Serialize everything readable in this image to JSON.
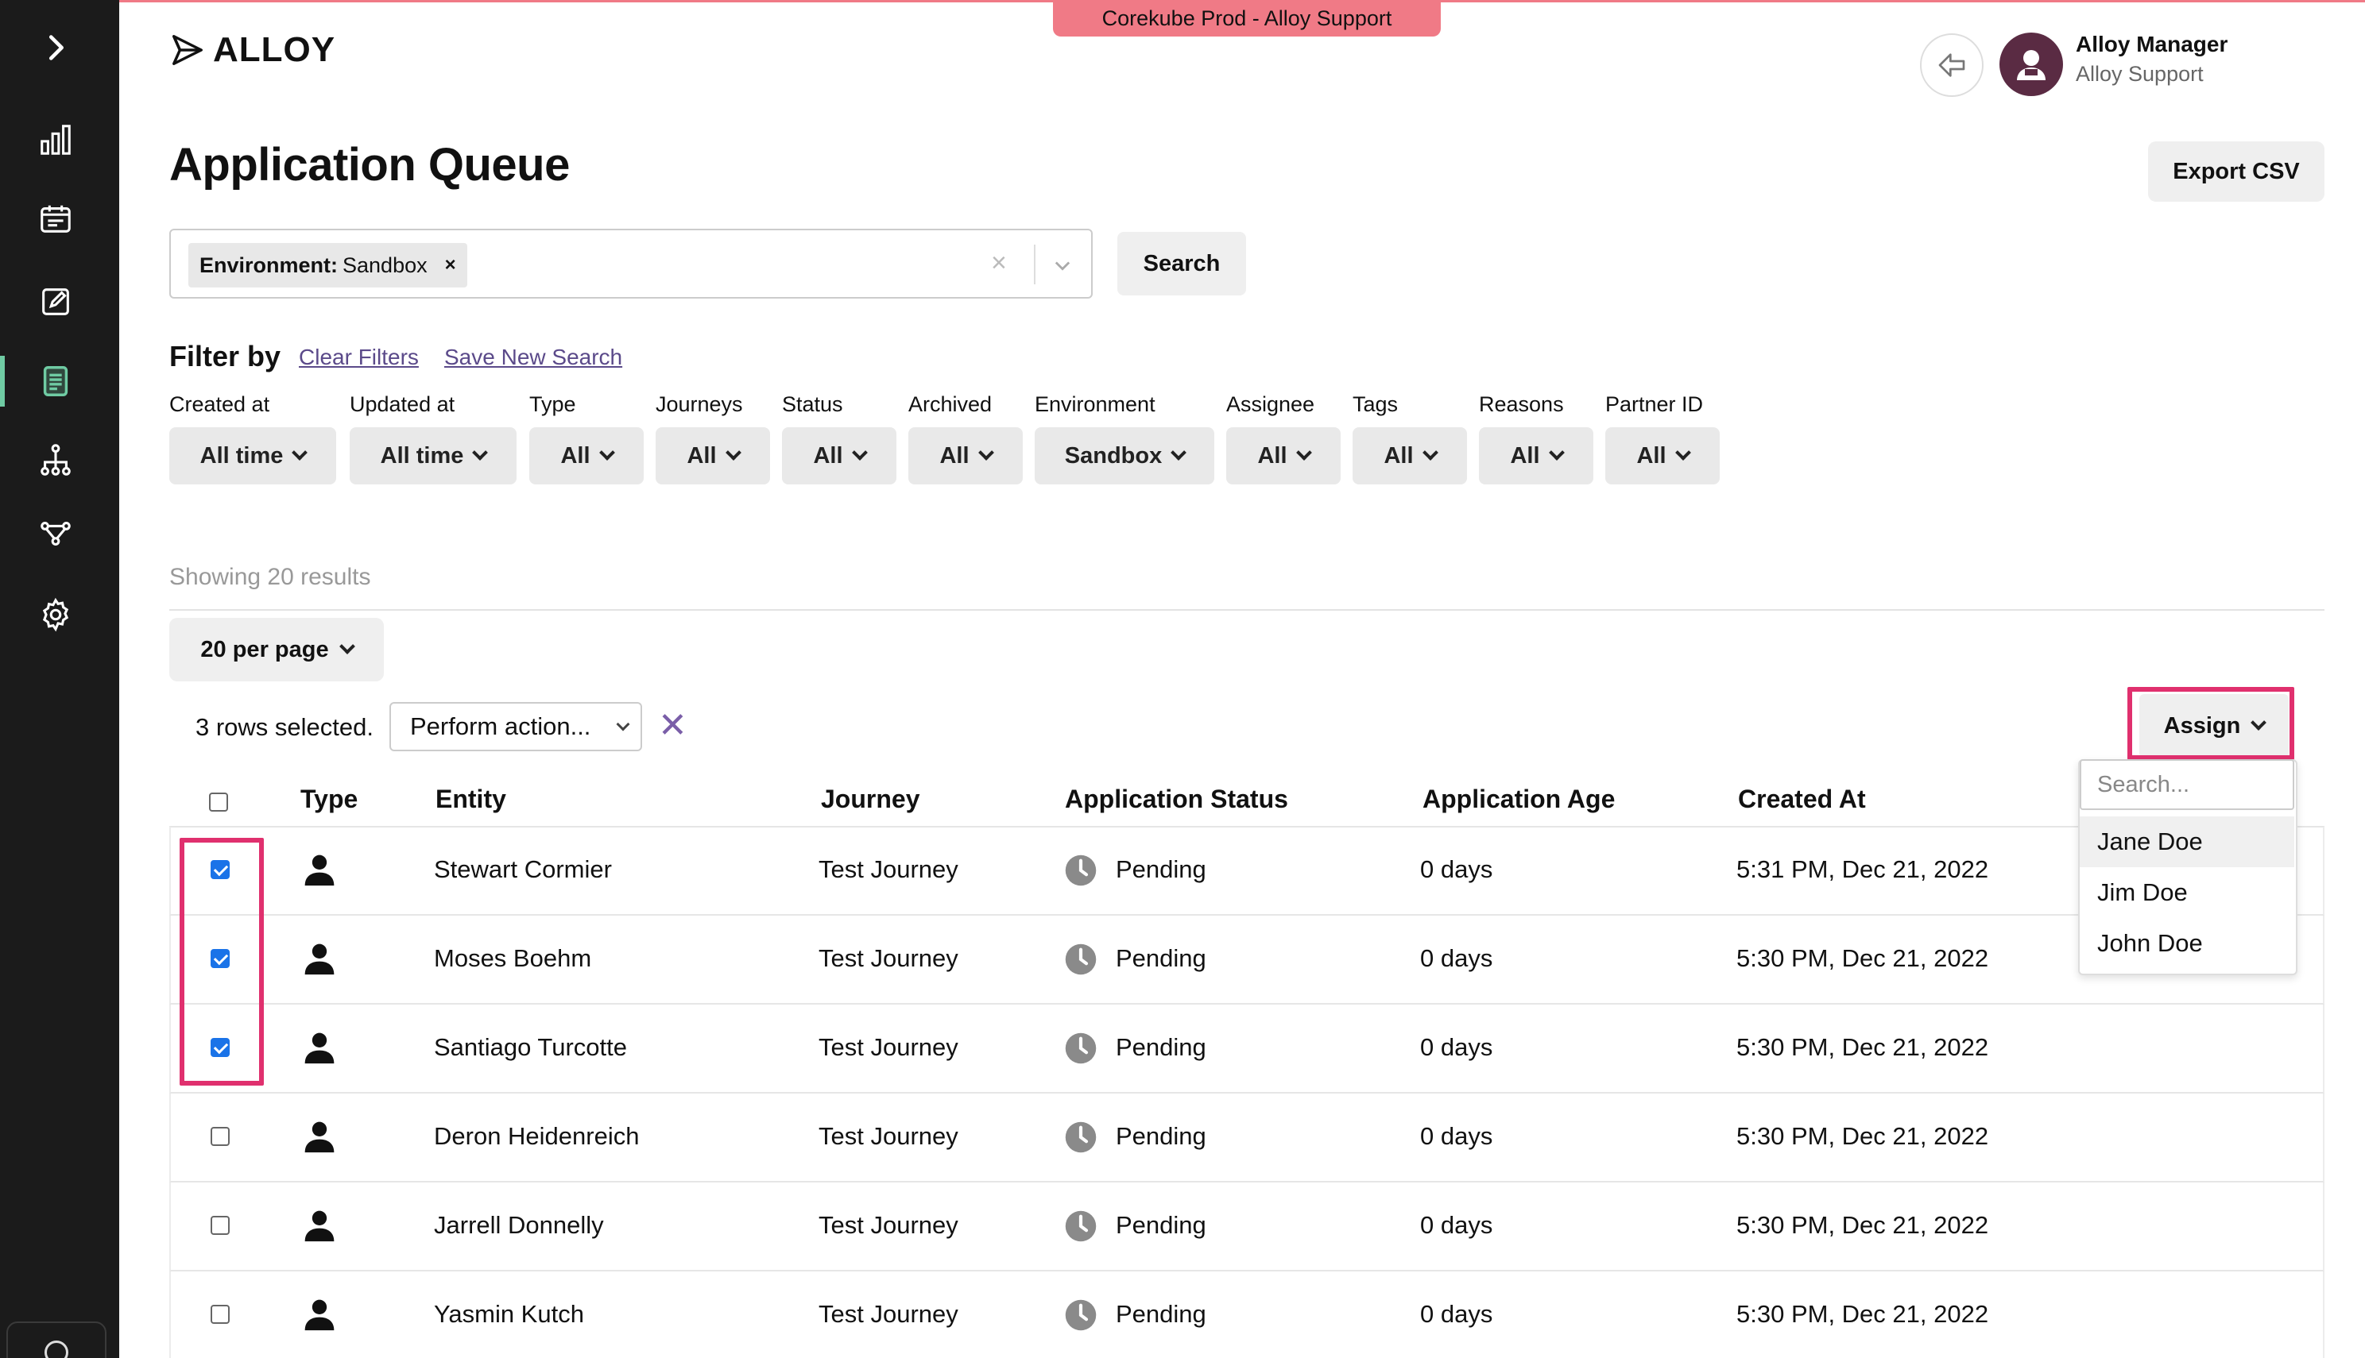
{
  "environment_badge": "Corekube Prod - Alloy Support",
  "brand": {
    "name": "ALLOY"
  },
  "user": {
    "name": "Alloy Manager",
    "org": "Alloy Support"
  },
  "sidebar": {
    "items": [
      {
        "icon": "chevron-right-icon"
      },
      {
        "icon": "bar-chart-icon"
      },
      {
        "icon": "inbox-icon"
      },
      {
        "icon": "edit-icon"
      },
      {
        "icon": "document-icon",
        "active": true
      },
      {
        "icon": "hierarchy-icon"
      },
      {
        "icon": "workflow-icon"
      },
      {
        "icon": "gear-icon"
      }
    ],
    "accent_color": "#6fcba3"
  },
  "page": {
    "title": "Application Queue",
    "export_label": "Export CSV"
  },
  "search": {
    "chip_key": "Environment:",
    "chip_value": "Sandbox",
    "chip_remove": "×",
    "clear": "×",
    "button_label": "Search"
  },
  "filters": {
    "heading": "Filter by",
    "clear_label": "Clear Filters",
    "save_label": "Save New Search",
    "items": [
      {
        "label": "Created at",
        "value": "All time"
      },
      {
        "label": "Updated at",
        "value": "All time"
      },
      {
        "label": "Type",
        "value": "All"
      },
      {
        "label": "Journeys",
        "value": "All"
      },
      {
        "label": "Status",
        "value": "All"
      },
      {
        "label": "Archived",
        "value": "All"
      },
      {
        "label": "Environment",
        "value": "Sandbox"
      },
      {
        "label": "Assignee",
        "value": "All"
      },
      {
        "label": "Tags",
        "value": "All"
      },
      {
        "label": "Reasons",
        "value": "All"
      },
      {
        "label": "Partner ID",
        "value": "All"
      }
    ]
  },
  "results": {
    "showing": "Showing 20 results",
    "per_page": "20 per page"
  },
  "bulk": {
    "rows_selected": "3 rows selected.",
    "action_placeholder": "Perform action...",
    "clear": "✕",
    "assign_label": "Assign"
  },
  "assign_dropdown": {
    "search_placeholder": "Search...",
    "options": [
      "Jane Doe",
      "Jim Doe",
      "John Doe"
    ]
  },
  "table": {
    "columns": [
      "Type",
      "Entity",
      "Journey",
      "Application Status",
      "Application Age",
      "Created At"
    ],
    "rows": [
      {
        "checked": true,
        "entity": "Stewart Cormier",
        "journey": "Test Journey",
        "status": "Pending",
        "age": "0 days",
        "created": "5:31 PM, Dec 21, 2022"
      },
      {
        "checked": true,
        "entity": "Moses Boehm",
        "journey": "Test Journey",
        "status": "Pending",
        "age": "0 days",
        "created": "5:30 PM, Dec 21, 2022"
      },
      {
        "checked": true,
        "entity": "Santiago Turcotte",
        "journey": "Test Journey",
        "status": "Pending",
        "age": "0 days",
        "created": "5:30 PM, Dec 21, 2022"
      },
      {
        "checked": false,
        "entity": "Deron Heidenreich",
        "journey": "Test Journey",
        "status": "Pending",
        "age": "0 days",
        "created": "5:30 PM, Dec 21, 2022"
      },
      {
        "checked": false,
        "entity": "Jarrell Donnelly",
        "journey": "Test Journey",
        "status": "Pending",
        "age": "0 days",
        "created": "5:30 PM, Dec 21, 2022"
      },
      {
        "checked": false,
        "entity": "Yasmin Kutch",
        "journey": "Test Journey",
        "status": "Pending",
        "age": "0 days",
        "created": "5:30 PM, Dec 21, 2022"
      }
    ]
  },
  "colors": {
    "highlight": "#e0306e",
    "badge": "#f07a86",
    "avatar": "#5a2b43",
    "checkbox": "#1a73e8"
  }
}
